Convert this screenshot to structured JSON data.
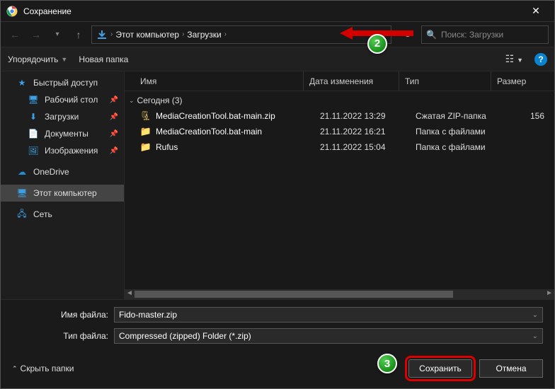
{
  "title": "Сохранение",
  "breadcrumb": {
    "pc": "Этот компьютер",
    "downloads": "Загрузки"
  },
  "search_placeholder": "Поиск: Загрузки",
  "toolbar": {
    "organize": "Упорядочить",
    "newfolder": "Новая папка"
  },
  "sidebar": {
    "quick": "Быстрый доступ",
    "desktop": "Рабочий стол",
    "downloads": "Загрузки",
    "documents": "Документы",
    "pictures": "Изображения",
    "onedrive": "OneDrive",
    "thispc": "Этот компьютер",
    "network": "Сеть"
  },
  "columns": {
    "name": "Имя",
    "date": "Дата изменения",
    "type": "Тип",
    "size": "Размер"
  },
  "group": "Сегодня (3)",
  "files": [
    {
      "name": "MediaCreationTool.bat-main.zip",
      "date": "21.11.2022 13:29",
      "type": "Сжатая ZIP-папка",
      "size": "156",
      "icon": "zip"
    },
    {
      "name": "MediaCreationTool.bat-main",
      "date": "21.11.2022 16:21",
      "type": "Папка с файлами",
      "size": "",
      "icon": "folder"
    },
    {
      "name": "Rufus",
      "date": "21.11.2022 15:04",
      "type": "Папка с файлами",
      "size": "",
      "icon": "folder"
    }
  ],
  "form": {
    "file_label": "Имя файла:",
    "file_value": "Fido-master.zip",
    "type_label": "Тип файла:",
    "type_value": "Compressed (zipped) Folder (*.zip)"
  },
  "actions": {
    "hide": "Скрыть папки",
    "save": "Сохранить",
    "cancel": "Отмена"
  },
  "annotations": {
    "b2": "2",
    "b3": "3"
  }
}
